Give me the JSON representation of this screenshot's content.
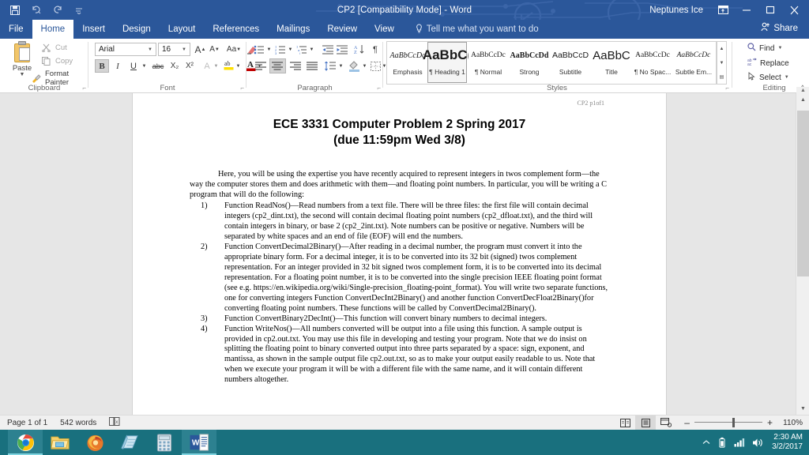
{
  "window": {
    "title": "CP2 [Compatibility Mode]  -  Word",
    "user": "Neptunes Ice",
    "quick_access": [
      {
        "name": "save-icon",
        "glyph": "ὋE"
      },
      {
        "name": "undo-icon",
        "glyph": "↶"
      },
      {
        "name": "redo-icon",
        "glyph": "↻"
      },
      {
        "name": "customize-qat-icon",
        "glyph": "⌵"
      }
    ],
    "buttons": {
      "ribbon_display_options": "⌷",
      "minimize": "—",
      "restore": "❐",
      "close": "✕"
    }
  },
  "tabs": [
    {
      "label": "File",
      "active": false,
      "file": true
    },
    {
      "label": "Home",
      "active": true,
      "file": false
    },
    {
      "label": "Insert",
      "active": false,
      "file": false
    },
    {
      "label": "Design",
      "active": false,
      "file": false
    },
    {
      "label": "Layout",
      "active": false,
      "file": false
    },
    {
      "label": "References",
      "active": false,
      "file": false
    },
    {
      "label": "Mailings",
      "active": false,
      "file": false
    },
    {
      "label": "Review",
      "active": false,
      "file": false
    },
    {
      "label": "View",
      "active": false,
      "file": false
    }
  ],
  "tellme": {
    "label": "Tell me what you want to do",
    "icon": "Ὂ1"
  },
  "share": {
    "label": "Share",
    "icon": "☺"
  },
  "ribbon": {
    "groups": [
      {
        "name": "Clipboard"
      },
      {
        "name": "Font"
      },
      {
        "name": "Paragraph"
      },
      {
        "name": "Styles"
      },
      {
        "name": "Editing"
      }
    ],
    "clipboard": {
      "paste_label": "Paste",
      "cut_label": "Cut",
      "copy_label": "Copy",
      "format_painter_label": "Format Painter"
    },
    "font": {
      "font_name": "Arial",
      "font_size": "16",
      "grow_font": "A",
      "shrink_font": "A",
      "change_case": "Aa",
      "clear_formatting": "὘C",
      "bold": "B",
      "italic": "I",
      "underline": "U",
      "strikethrough": "abc",
      "subscript": "X₂",
      "superscript": "X²",
      "text_effects": "A",
      "highlight": "ab",
      "font_color": "A"
    },
    "paragraph": {
      "bullets": "≡",
      "numbering": "≡",
      "multilevel": "≡",
      "decrease_indent": "⇤",
      "increase_indent": "⇥",
      "sort": "A↓",
      "show_marks": "¶",
      "align_left": "≡",
      "align_center": "≡",
      "align_right": "≡",
      "justify": "≡",
      "line_spacing": "↕",
      "shading": "◳",
      "borders": "⬚"
    },
    "styles": [
      {
        "preview": "AaBbCcDc",
        "name": "Emphasis",
        "selected": false,
        "style": "italic-serif"
      },
      {
        "preview": "AaBbC(",
        "name": "¶ Heading 1",
        "selected": true,
        "style": "h1"
      },
      {
        "preview": "AaBbCcDc",
        "name": "¶ Normal",
        "selected": false,
        "style": "normal"
      },
      {
        "preview": "AaBbCcDd",
        "name": "Strong",
        "selected": false,
        "style": "bold"
      },
      {
        "preview": "AaBbCcD",
        "name": "Subtitle",
        "selected": false,
        "style": "normal"
      },
      {
        "preview": "AaBbC",
        "name": "Title",
        "selected": false,
        "style": "title"
      },
      {
        "preview": "AaBbCcDc",
        "name": "¶ No Spac...",
        "selected": false,
        "style": "normal"
      },
      {
        "preview": "AaBbCcDc",
        "name": "Subtle Em...",
        "selected": false,
        "style": "italic-serif"
      }
    ],
    "editing": {
      "find": "Find",
      "replace": "Replace",
      "select": "Select",
      "find_icon": "ὐD",
      "replace_icon": "ab",
      "select_icon": "➤"
    },
    "collapse_ribbon": "⌃"
  },
  "document": {
    "header_right": "CP2 p1of1",
    "title_line1": "ECE 3331 Computer Problem 2 Spring 2017",
    "title_line2": "(due 11:59pm Wed 3/8)",
    "intro": "Here, you will be using the expertise you have recently acquired to represent integers in twos complement form—the way the computer stores them and does arithmetic with them—and floating point numbers. In particular, you will be writing a C program that will do the following:",
    "items": [
      {
        "num": "1)",
        "text": "Function ReadNos()—Read numbers from a text file. There will be three files:  the first file will contain decimal integers (cp2_dint.txt), the second will contain decimal floating point numbers (cp2_dfloat.txt), and the third will contain integers in binary, or base 2 (cp2_2int.txt). Note numbers can be positive or negative. Numbers will be separated by white spaces and an end of file (EOF) will end the numbers."
      },
      {
        "num": "2)",
        "text": "Function ConvertDecimal2Binary()—After reading in a decimal number, the program must convert it into the appropriate binary form. For a decimal integer, it is to be converted into its 32 bit (signed) twos complement representation. For an integer provided in 32 bit signed twos complement form, it is to be converted into its decimal representation. For a floating point number, it is to be converted into the single precision IEEE floating point format (see e.g. https://en.wikipedia.org/wiki/Single-precision_floating-point_format). You will write two separate functions, one for converting integers Function ConvertDecInt2Binary() and another function ConvertDecFloat2Binary()for converting floating point numbers. These functions will be called by ConvertDecimal2Binary()."
      },
      {
        "num": "3)",
        "text": "Function ConvertBinary2DecInt()—This function will  convert binary numbers to decimal integers."
      },
      {
        "num": "4)",
        "text": "Function WriteNos()—All numbers converted will be output into a file using this function.   A sample output is provided in cp2.out.txt. You may use this file in developing and testing your program. Note that we do insist on splitting the floating point to binary converted output into three parts separated by a space: sign, exponent, and mantissa, as shown in the sample output file cp2.out.txt, so as to make your output easily readable to us. Note that when we execute your program it will be with a different file with the same name, and it will contain different numbers altogether."
      }
    ]
  },
  "statusbar": {
    "page": "Page 1 of 1",
    "words": "542 words",
    "proofing_icon": "Ὅ6",
    "views": [
      {
        "name": "read-mode",
        "glyph": "Ὅ6",
        "active": false
      },
      {
        "name": "print-layout",
        "glyph": "☰",
        "active": true
      },
      {
        "name": "web-layout",
        "glyph": "὜E",
        "active": false
      }
    ],
    "zoom_out": "–",
    "zoom_in": "+",
    "zoom_level": "110%"
  },
  "taskbar": {
    "apps": [
      {
        "name": "chrome",
        "running": true
      },
      {
        "name": "file-explorer",
        "running": false
      },
      {
        "name": "firefox",
        "running": false
      },
      {
        "name": "notepad",
        "running": false
      },
      {
        "name": "calculator",
        "running": false
      },
      {
        "name": "word",
        "running": true
      }
    ],
    "tray": {
      "show_hidden": "▲",
      "battery": "ὐB",
      "network": "὏6",
      "volume": "ὐA",
      "time": "2:30 AM",
      "date": "3/2/2017"
    }
  },
  "colors": {
    "word_blue": "#2b579a",
    "taskbar": "#19707e",
    "ribbon_bg": "#ffffff",
    "doc_bg": "#e6e6e6"
  }
}
